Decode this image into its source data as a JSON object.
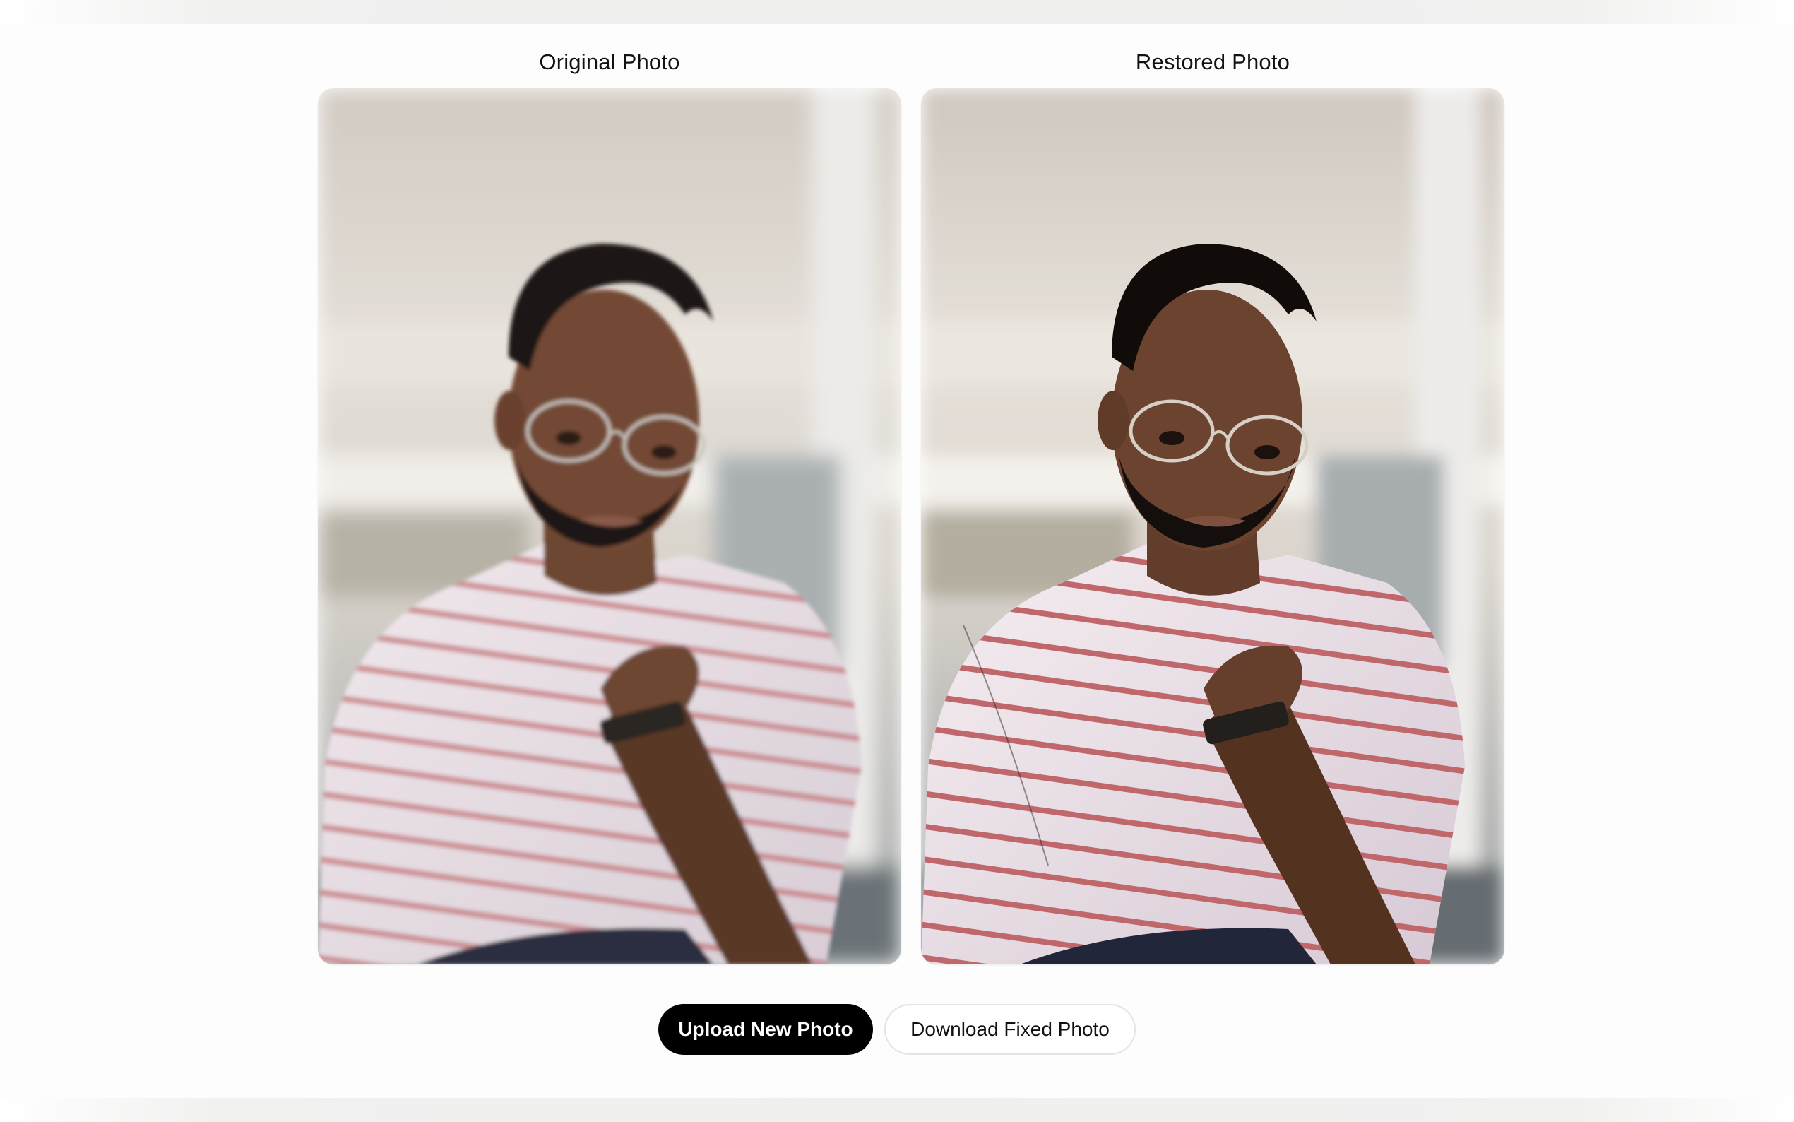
{
  "panels": {
    "original": {
      "title": "Original Photo"
    },
    "restored": {
      "title": "Restored Photo"
    }
  },
  "actions": {
    "upload_label": "Upload New Photo",
    "download_label": "Download Fixed Photo"
  },
  "colors": {
    "primary_button_bg": "#000000",
    "primary_button_text": "#ffffff",
    "secondary_button_border": "#e4e4e4",
    "page_background": "#fdfdfd"
  }
}
